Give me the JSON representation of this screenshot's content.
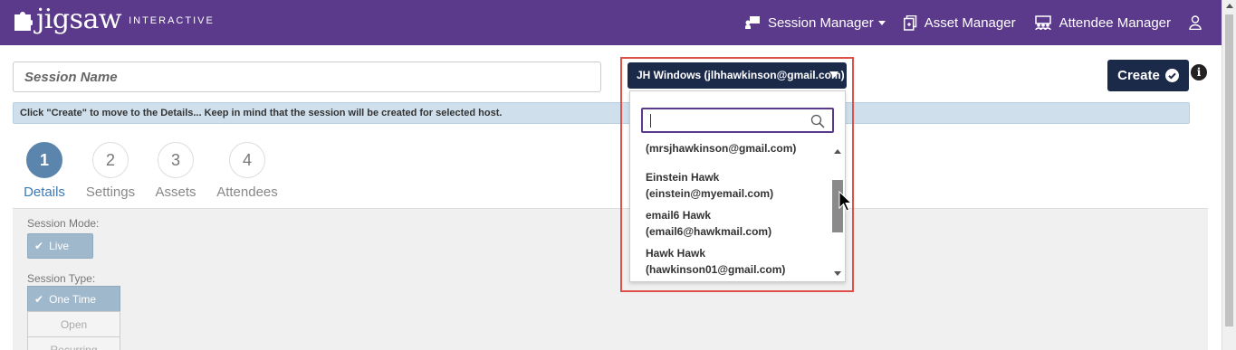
{
  "brand": {
    "name": "jigsaw",
    "suffix": "INTERACTIVE"
  },
  "nav": {
    "session_manager": "Session Manager",
    "asset_manager": "Asset Manager",
    "attendee_manager": "Attendee Manager"
  },
  "session_name": {
    "placeholder": "Session Name",
    "value": ""
  },
  "banner": "Click \"Create\" to move to the Details... Keep in mind that the session will be created for selected host.",
  "host_select": {
    "selected": "JH Windows (jlhhawkinson@gmail.com)"
  },
  "host_dropdown": {
    "search_value": "",
    "items": [
      {
        "name": "",
        "email": "(mrsjhawkinson@gmail.com)"
      },
      {
        "name": "Einstein Hawk",
        "email": "(einstein@myemail.com)"
      },
      {
        "name": "email6 Hawk",
        "email": "(email6@hawkmail.com)"
      },
      {
        "name": "Hawk Hawk",
        "email": "(hawkinson01@gmail.com)"
      }
    ]
  },
  "create_button": "Create",
  "info_icon": "i",
  "steps": [
    {
      "number": "1",
      "label": "Details",
      "active": true
    },
    {
      "number": "2",
      "label": "Settings",
      "active": false
    },
    {
      "number": "3",
      "label": "Assets",
      "active": false
    },
    {
      "number": "4",
      "label": "Attendees",
      "active": false
    }
  ],
  "session_mode": {
    "label": "Session Mode:",
    "option": "Live"
  },
  "session_type": {
    "label": "Session Type:",
    "options": [
      "One Time",
      "Open",
      "Recurring"
    ],
    "selected": "One Time"
  },
  "colors": {
    "topbar": "#5b3a8c",
    "primary": "#1c2a4a",
    "highlight": "#e0504a",
    "step_active": "#5b85ad"
  }
}
